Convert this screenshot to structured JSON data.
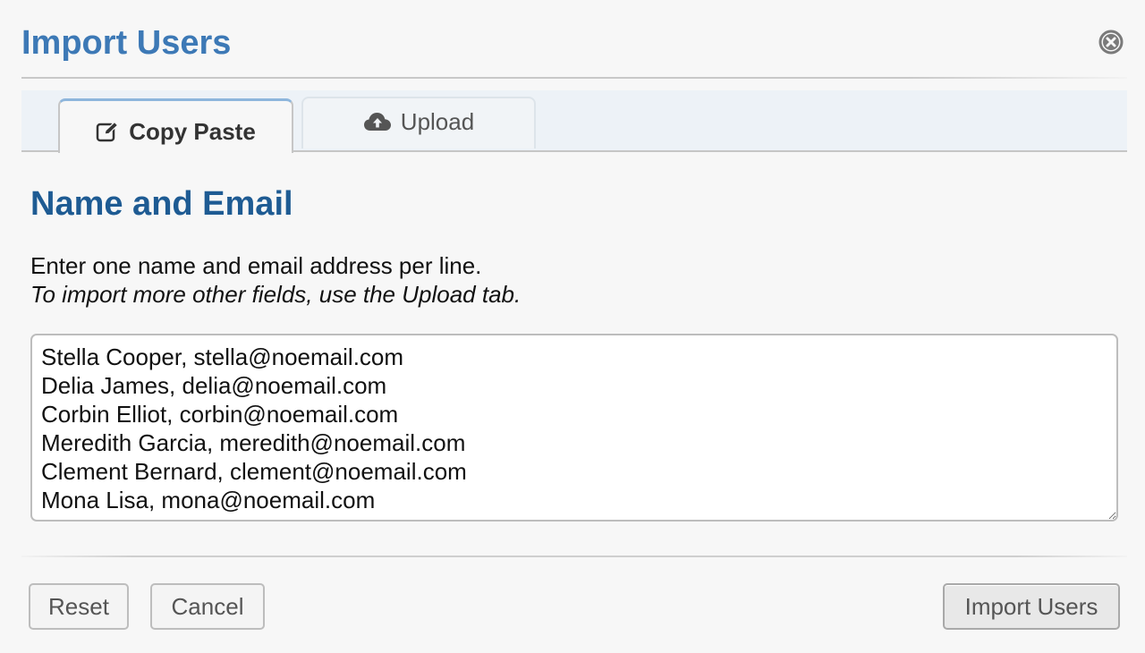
{
  "dialog": {
    "title": "Import Users",
    "close_icon": "close-circle-icon"
  },
  "tabs": [
    {
      "label": "Copy Paste",
      "icon": "edit-icon",
      "active": true
    },
    {
      "label": "Upload",
      "icon": "cloud-upload-icon",
      "active": false
    }
  ],
  "section": {
    "heading": "Name and Email",
    "instruction": "Enter one name and email address per line.",
    "hint": "To import more other fields, use the Upload tab."
  },
  "textarea": {
    "value": "Stella Cooper, stella@noemail.com\nDelia James, delia@noemail.com\nCorbin Elliot, corbin@noemail.com\nMeredith Garcia, meredith@noemail.com\nClement Bernard, clement@noemail.com\nMona Lisa, mona@noemail.com"
  },
  "buttons": {
    "reset": "Reset",
    "cancel": "Cancel",
    "import": "Import Users"
  },
  "colors": {
    "title": "#3d79b6",
    "heading": "#1e5b93",
    "tab_bar": "#edf2f7"
  }
}
